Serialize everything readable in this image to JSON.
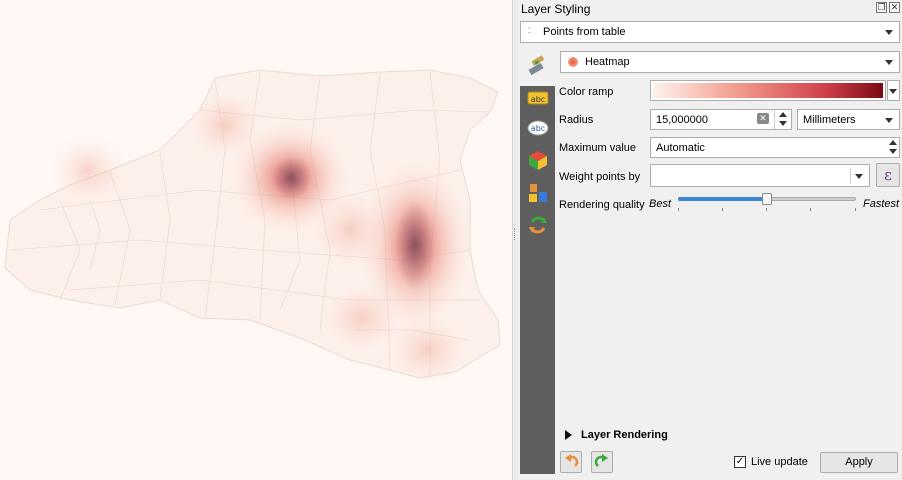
{
  "panel": {
    "title": "Layer Styling",
    "layer_select": "Points from table",
    "renderer_select": "Heatmap",
    "colors": {
      "ramp_start": "#fff2ee",
      "ramp_end": "#7a0a14",
      "slider_fill": "#3a86d8"
    }
  },
  "form": {
    "color_ramp_label": "Color ramp",
    "radius_label": "Radius",
    "radius_value": "15,000000",
    "radius_unit": "Millimeters",
    "max_value_label": "Maximum value",
    "max_value_value": "Automatic",
    "weight_label": "Weight points by",
    "weight_value": "",
    "expression_symbol": "ε",
    "quality_label": "Rendering quality",
    "quality_min_label": "Best",
    "quality_max_label": "Fastest",
    "quality_level": 0.5
  },
  "sidebar_tabs": [
    "symbology-icon",
    "labels-icon",
    "masks-icon",
    "3d-view-icon",
    "diagrams-icon",
    "history-icon"
  ],
  "sidebar_label_text": "abc",
  "layer_rendering_label": "Layer Rendering",
  "footer": {
    "live_update_label": "Live update",
    "live_update_checked": true,
    "apply_label": "Apply"
  }
}
